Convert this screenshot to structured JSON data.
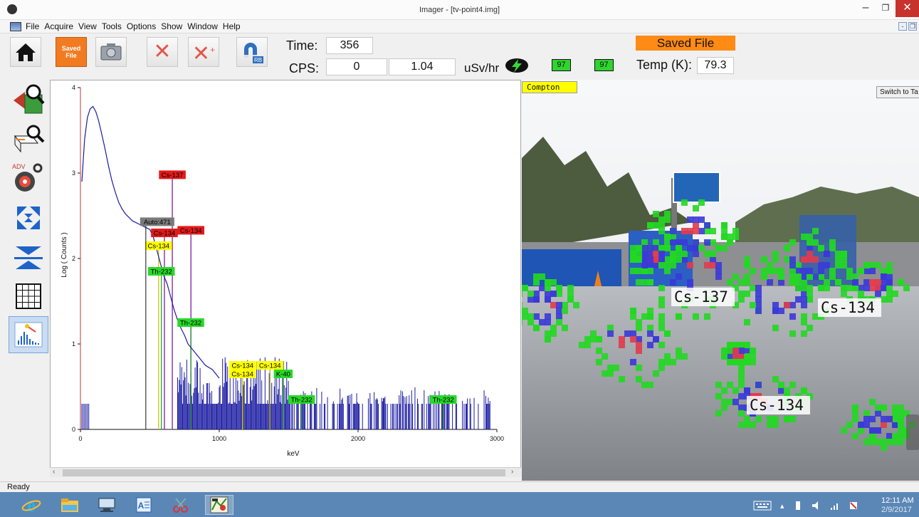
{
  "window": {
    "title": "Imager - [tv-point4.img]",
    "min": "–",
    "max": "❐",
    "close": "✕"
  },
  "menu": {
    "items": [
      "File",
      "Acquire",
      "View",
      "Tools",
      "Options",
      "Show",
      "Window",
      "Help"
    ],
    "mdi": [
      "-",
      "❐"
    ]
  },
  "toolbar": {
    "saved_icon_text": "Saved\nFile",
    "time_label": "Time:",
    "time_value": "356",
    "cps_label": "CPS:",
    "cps_value": "0",
    "dose_value": "1.04",
    "dose_unit": "uSv/hr",
    "badge_a": "97",
    "badge_b": "97",
    "saved_banner": "Saved File",
    "temp_label": "Temp (K):",
    "temp_value": "79.3",
    "rb_text": "RB",
    "adv_text": "ADV"
  },
  "spectrum": {
    "ylabel": "Log ( Counts )",
    "xlabel": "keV",
    "auto_marker": "Auto:471"
  },
  "chart_data": {
    "type": "line",
    "title": "",
    "xlabel": "keV",
    "ylabel": "Log ( Counts )",
    "xlim": [
      0,
      3000
    ],
    "ylim": [
      0,
      4
    ],
    "xticks": [
      0,
      1000,
      2000,
      3000
    ],
    "yticks": [
      0,
      1,
      2,
      3,
      4
    ],
    "grid": false,
    "series": [
      {
        "x": [
          10,
          30,
          50,
          70,
          90,
          110,
          130,
          150,
          175,
          200,
          225,
          250,
          275,
          300,
          325,
          350,
          375,
          400,
          425,
          450,
          475,
          500,
          525,
          550,
          575,
          600,
          625,
          650,
          675,
          700,
          725,
          750,
          775,
          800,
          850,
          900,
          950,
          1000
        ],
        "y": [
          2.9,
          3.4,
          3.65,
          3.75,
          3.78,
          3.72,
          3.62,
          3.48,
          3.3,
          3.1,
          2.92,
          2.78,
          2.66,
          2.58,
          2.52,
          2.48,
          2.44,
          2.42,
          2.4,
          2.38,
          2.36,
          2.34,
          2.25,
          2.1,
          1.95,
          1.8,
          1.7,
          1.55,
          1.4,
          1.28,
          1.18,
          1.1,
          1.0,
          0.95,
          0.85,
          0.75,
          0.7,
          0.6
        ]
      }
    ],
    "markers": [
      {
        "label": "Cs-137",
        "kev": 662,
        "level": 2.93,
        "kind": "red"
      },
      {
        "label": "Cs-134",
        "kev": 796,
        "level": 2.28,
        "kind": "red"
      },
      {
        "label": "Cs-134",
        "kev": 605,
        "level": 2.25,
        "kind": "red"
      },
      {
        "label": "Cs-134",
        "kev": 563,
        "level": 2.1,
        "kind": "yellow"
      },
      {
        "label": "Th-232",
        "kev": 583,
        "level": 1.8,
        "kind": "green"
      },
      {
        "label": "Th-232",
        "kev": 795,
        "level": 1.2,
        "kind": "green"
      },
      {
        "label": "Cs-134",
        "kev": 1168,
        "level": 0.7,
        "kind": "yellow"
      },
      {
        "label": "Cs-134",
        "kev": 1167,
        "level": 0.6,
        "kind": "yellow"
      },
      {
        "label": "Cs-134",
        "kev": 1365,
        "level": 0.7,
        "kind": "yellow"
      },
      {
        "label": "K-40",
        "kev": 1461,
        "level": 0.6,
        "kind": "green"
      },
      {
        "label": "Th-232",
        "kev": 1593,
        "level": 0.3,
        "kind": "green"
      },
      {
        "label": "Th-232",
        "kev": 2614,
        "level": 0.3,
        "kind": "green"
      }
    ]
  },
  "image_view": {
    "mode": "Compton",
    "switch_button": "Switch to Ta",
    "labels": [
      {
        "text": "Cs-137"
      },
      {
        "text": "Cs-134"
      },
      {
        "text": "Cs-134"
      }
    ]
  },
  "status": {
    "text": "Ready"
  },
  "taskbar": {
    "clock_time": "12:11 AM",
    "clock_date": "2/9/2017"
  }
}
